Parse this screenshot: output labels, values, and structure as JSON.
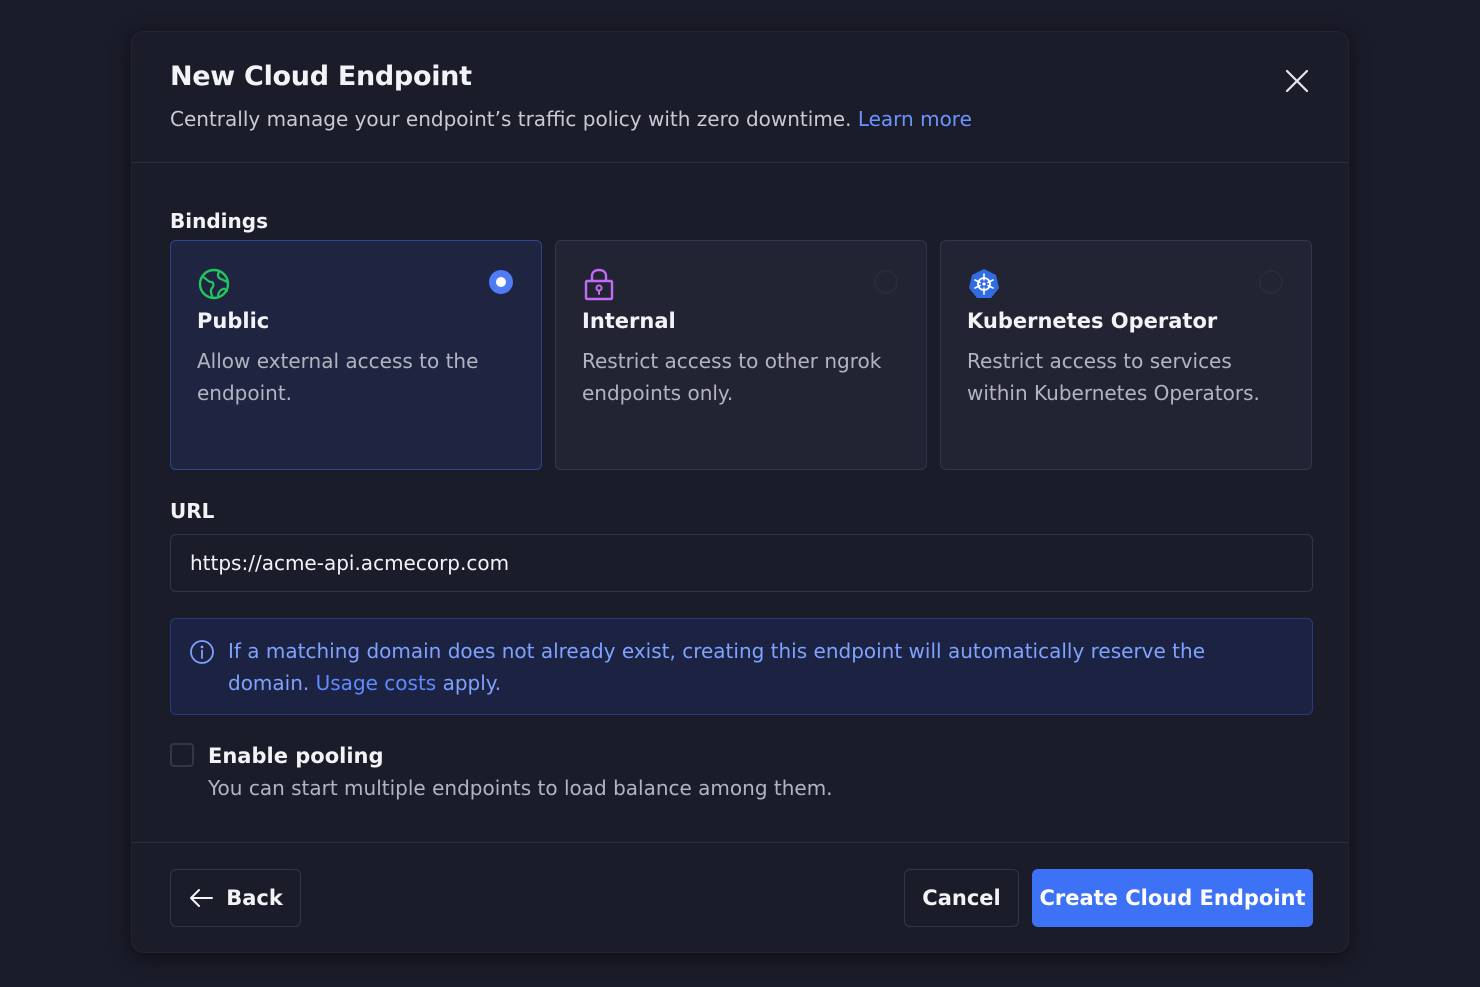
{
  "dialog": {
    "title": "New Cloud Endpoint",
    "subtitle": "Centrally manage your endpoint’s traffic policy with zero downtime.",
    "learn_more": "Learn more"
  },
  "bindings": {
    "label": "Bindings",
    "selected": "Public",
    "options": [
      {
        "icon": "globe-icon",
        "title": "Public",
        "description": "Allow external access to the endpoint.",
        "selected": true,
        "icon_color": "#22c55e"
      },
      {
        "icon": "lock-icon",
        "title": "Internal",
        "description": "Restrict access to other ngrok endpoints only.",
        "selected": false,
        "icon_color": "#c26cf5"
      },
      {
        "icon": "kubernetes-icon",
        "title": "Kubernetes Operator",
        "description": "Restrict access to services within Kubernetes Operators.",
        "selected": false,
        "icon_color": "#326ce5"
      }
    ]
  },
  "url": {
    "label": "URL",
    "value": "https://acme-api.acmecorp.com"
  },
  "info": {
    "icon": "info-icon",
    "text": "If a matching domain does not already exist, creating this endpoint will automatically reserve the domain.",
    "link": "Usage costs",
    "suffix": "apply."
  },
  "pooling": {
    "title": "Enable pooling",
    "description": "You can start multiple endpoints to load balance among them.",
    "checked": false
  },
  "footer": {
    "back_label": "Back",
    "cancel_label": "Cancel",
    "create_label": "Create Cloud Endpoint"
  },
  "colors": {
    "accent": "#3d72f6",
    "link": "#6a93ff",
    "background": "#1b1c2a"
  }
}
